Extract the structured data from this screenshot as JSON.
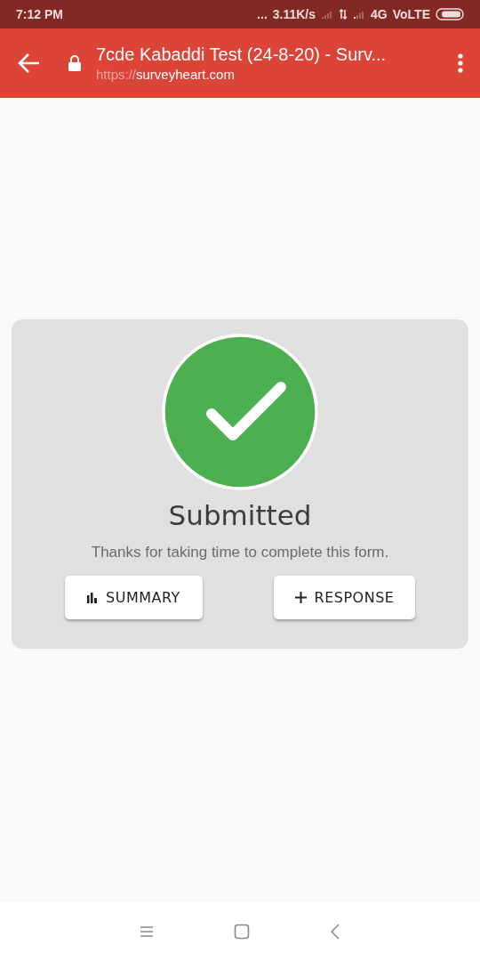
{
  "status_bar": {
    "time": "7:12 PM",
    "dots": "...",
    "speed": "3.11K/s",
    "network": "4G",
    "volte": "VoLTE"
  },
  "browser_bar": {
    "title": "7cde Kabaddi Test (24-8-20) - Surv...",
    "url_scheme": "https://",
    "url_host": "surveyheart.com"
  },
  "card": {
    "heading": "Submitted",
    "message": "Thanks for taking time to complete this form.",
    "buttons": [
      {
        "kind": "summary",
        "label": "SUMMARY"
      },
      {
        "kind": "response",
        "label": "RESPONSE"
      }
    ]
  }
}
